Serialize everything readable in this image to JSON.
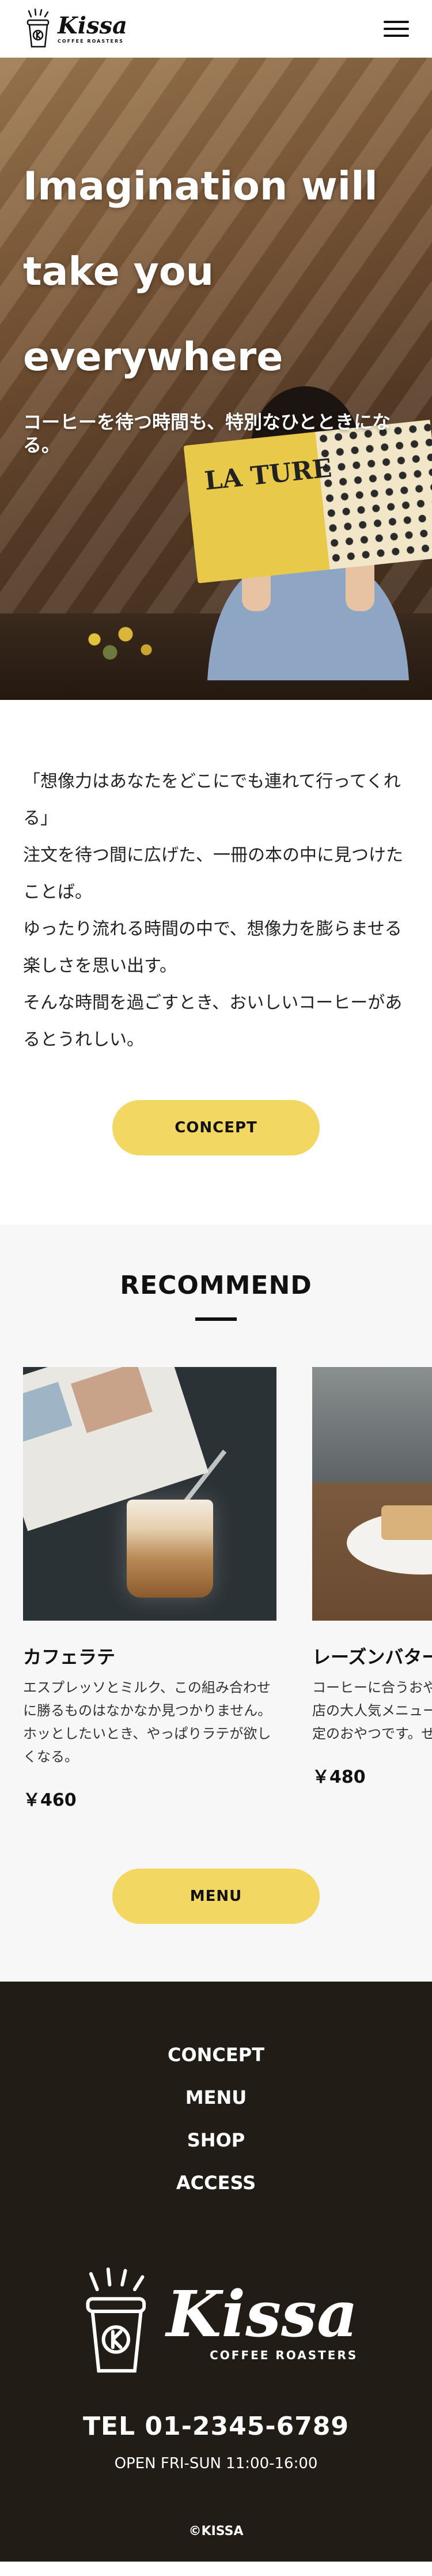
{
  "header": {
    "logo_word": "Kissa",
    "logo_sub": "COFFEE ROASTERS"
  },
  "hero": {
    "title": "Imagination will take you everywhere",
    "subtitle": "コーヒーを待つ時間も、特別なひとときになる。",
    "book_text": "LA TURE"
  },
  "concept": {
    "paragraphs": [
      "「想像力はあなたをどこにでも連れて行ってくれる」",
      "注文を待つ間に広げた、一冊の本の中に見つけたことば。",
      "ゆったり流れる時間の中で、想像力を膨らませる楽しさを思い出す。",
      "そんな時間を過ごすとき、おいしいコーヒーがあるとうれしい。"
    ],
    "button_label": "CONCEPT"
  },
  "recommend": {
    "title": "RECOMMEND",
    "items": [
      {
        "name": "カフェラテ",
        "description": "エスプレッソとミルク、この組み合わせに勝るものはなかなか見つかりません。ホッとしたいとき、やっぱりラテが欲しくなる。",
        "price": "￥460"
      },
      {
        "name": "レーズンバターサンド",
        "description": "コーヒーに合うおやつとして生まれた当店の大人気メニュー。数量・季節共に限定のおやつです。ぜひお試しを。",
        "price": "￥480"
      }
    ],
    "button_label": "MENU"
  },
  "footer": {
    "nav": [
      "CONCEPT",
      "MENU",
      "SHOP",
      "ACCESS"
    ],
    "logo_word": "Kissa",
    "logo_sub": "COFFEE ROASTERS",
    "tel": "TEL 01-2345-6789",
    "hours": "OPEN FRI-SUN 11:00-16:00",
    "copyright": "©KISSA"
  },
  "colors": {
    "accent_yellow": "#f2d862",
    "footer_bg": "#221c17",
    "section_bg": "#f7f7f7"
  }
}
